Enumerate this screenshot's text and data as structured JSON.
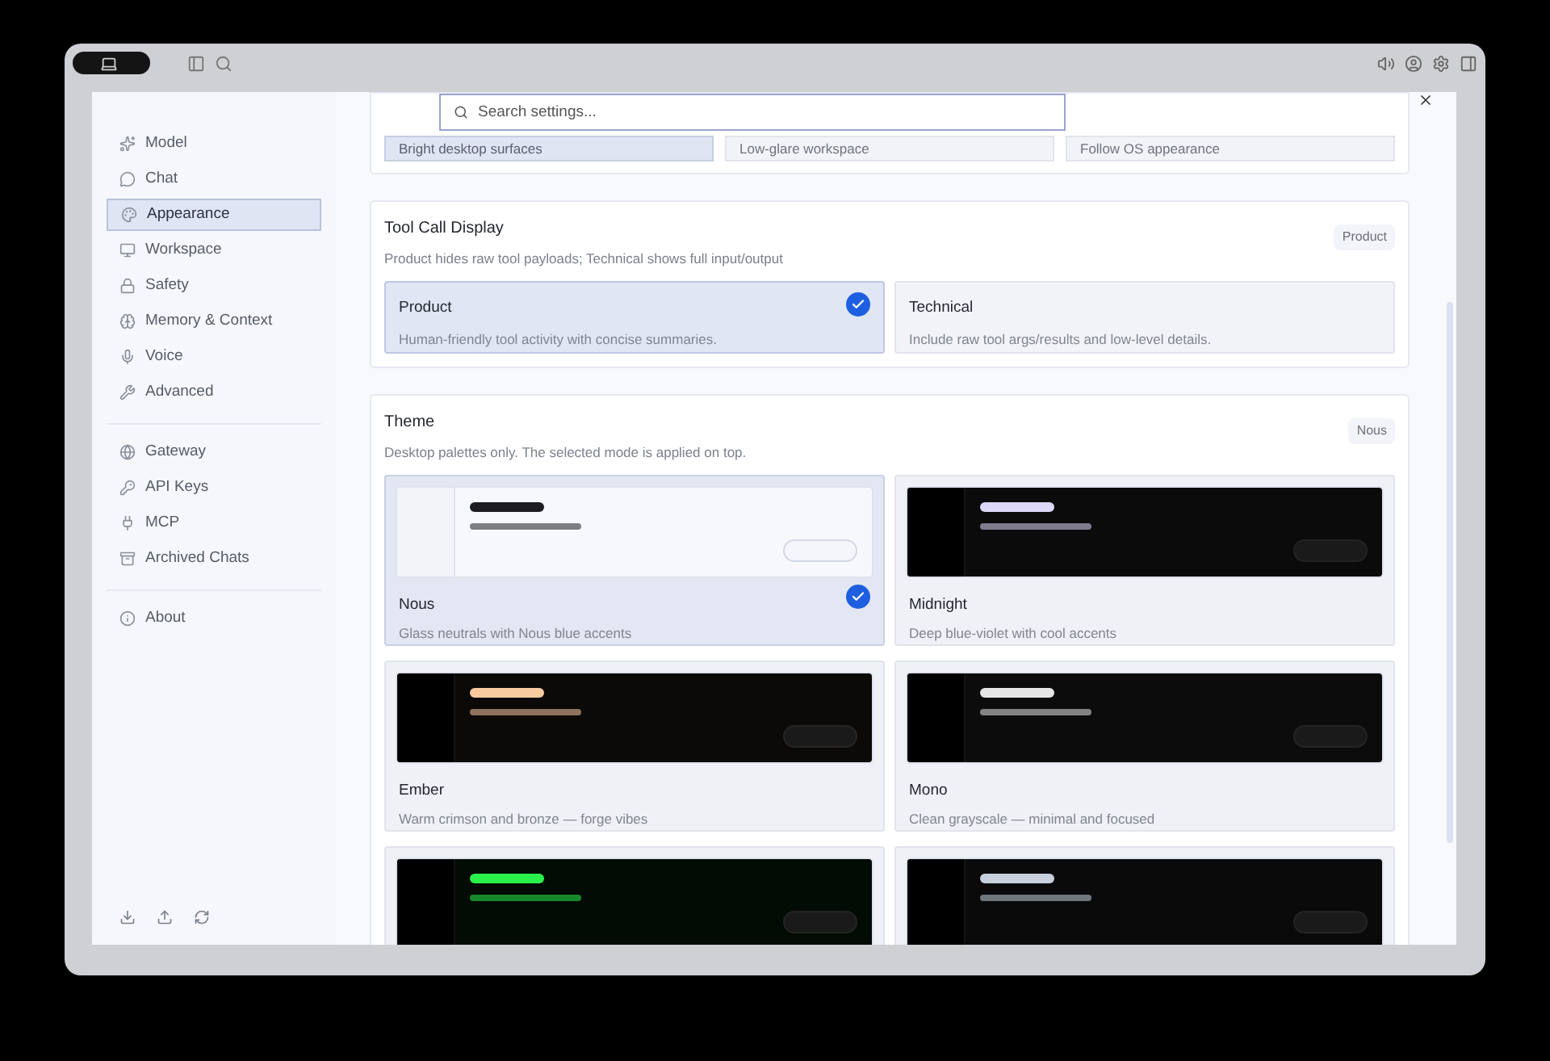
{
  "search": {
    "placeholder": "Search settings..."
  },
  "sidebar": {
    "groups": [
      {
        "items": [
          {
            "label": "Model",
            "selected": false
          },
          {
            "label": "Chat",
            "selected": false
          },
          {
            "label": "Appearance",
            "selected": true
          },
          {
            "label": "Workspace",
            "selected": false
          },
          {
            "label": "Safety",
            "selected": false
          },
          {
            "label": "Memory & Context",
            "selected": false
          },
          {
            "label": "Voice",
            "selected": false
          },
          {
            "label": "Advanced",
            "selected": false
          }
        ]
      },
      {
        "items": [
          {
            "label": "Gateway",
            "selected": false
          },
          {
            "label": "API Keys",
            "selected": false
          },
          {
            "label": "MCP",
            "selected": false
          },
          {
            "label": "Archived Chats",
            "selected": false
          }
        ]
      },
      {
        "items": [
          {
            "label": "About",
            "selected": false
          }
        ]
      }
    ]
  },
  "mode_options": [
    {
      "label": "Bright desktop surfaces",
      "selected": true
    },
    {
      "label": "Low-glare workspace",
      "selected": false
    },
    {
      "label": "Follow OS appearance",
      "selected": false
    }
  ],
  "tool_call_display": {
    "title": "Tool Call Display",
    "description": "Product hides raw tool payloads; Technical shows full input/output",
    "badge": "Product",
    "options": [
      {
        "title": "Product",
        "description": "Human-friendly tool activity with concise summaries.",
        "selected": true
      },
      {
        "title": "Technical",
        "description": "Include raw tool args/results and low-level details.",
        "selected": false
      }
    ]
  },
  "theme": {
    "title": "Theme",
    "description": "Desktop palettes only. The selected mode is applied on top.",
    "badge": "Nous",
    "options": [
      {
        "name": "Nous",
        "description": "Glass neutrals with Nous blue accents",
        "selected": true,
        "color": "#1c1c22"
      },
      {
        "name": "Midnight",
        "description": "Deep blue-violet with cool accents",
        "selected": false,
        "color": "#ddd8f8"
      },
      {
        "name": "Ember",
        "description": "Warm crimson and bronze — forge vibes",
        "selected": false,
        "color": "#f8caa0"
      },
      {
        "name": "Mono",
        "description": "Clean grayscale — minimal and focused",
        "selected": false,
        "color": "#e6e6e6"
      },
      {
        "selected": false,
        "color": "#2af04a"
      },
      {
        "selected": false,
        "color": "#c8d0dc"
      }
    ]
  }
}
